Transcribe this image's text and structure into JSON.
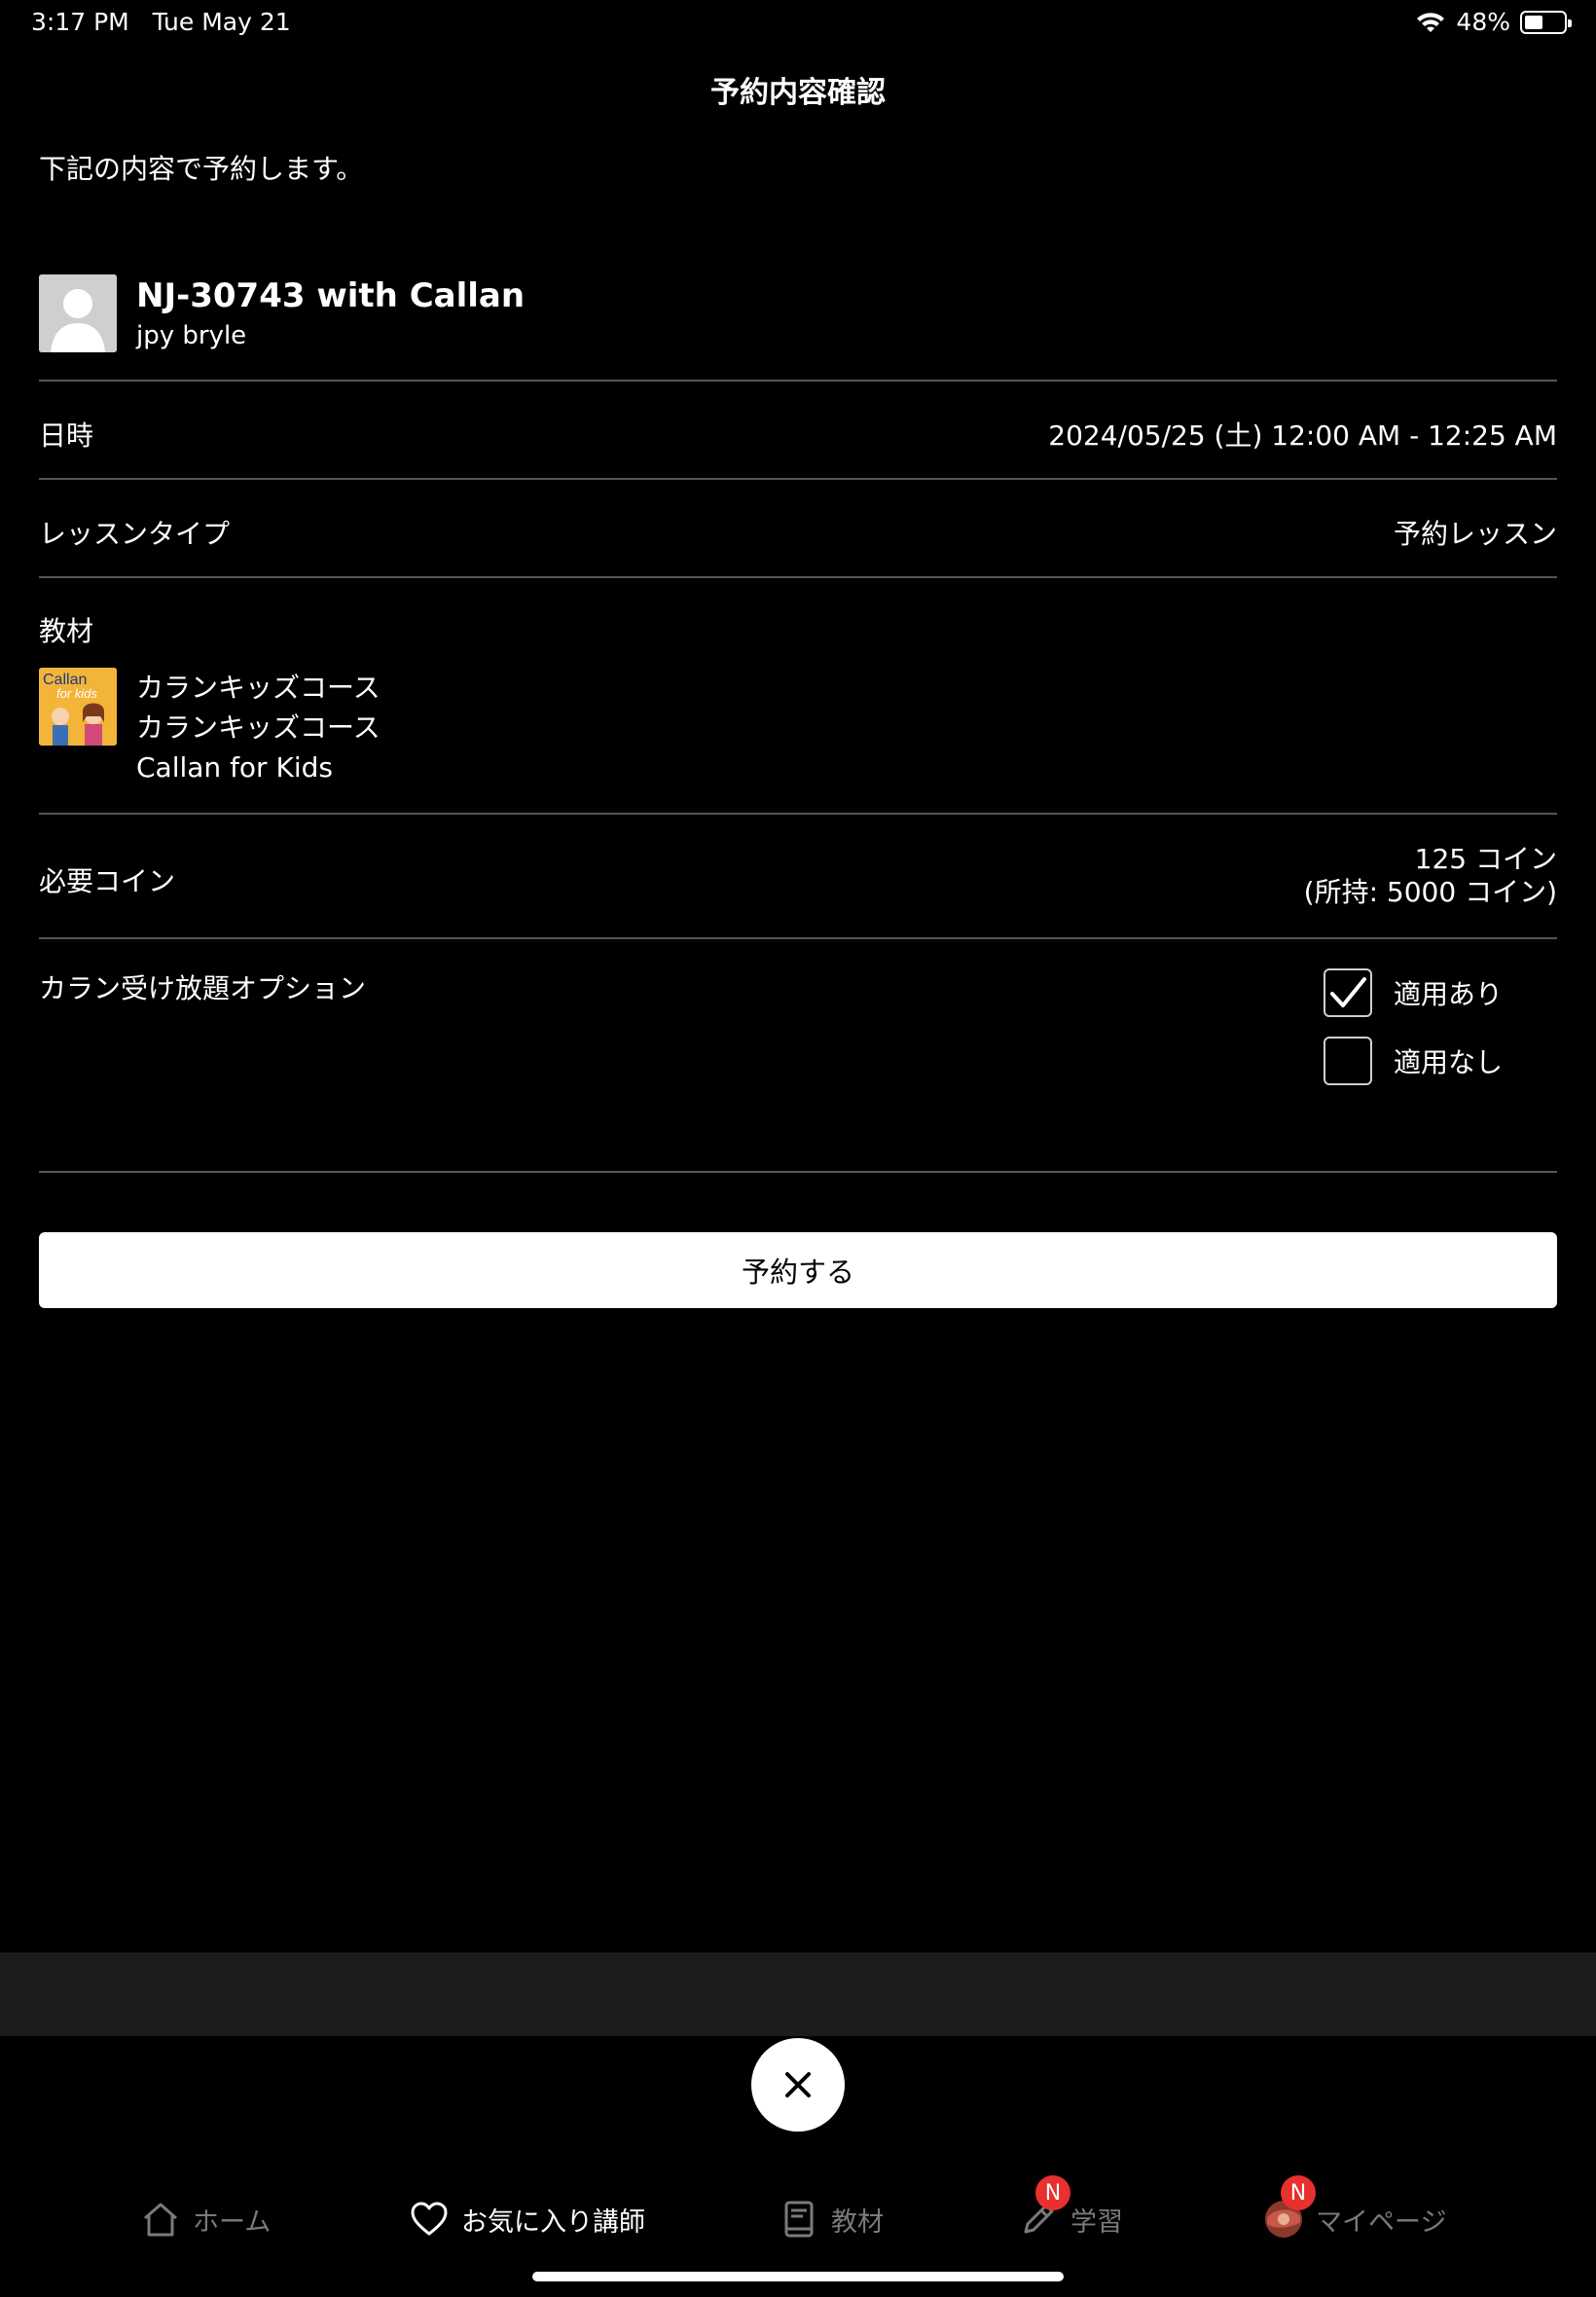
{
  "status_bar": {
    "time": "3:17 PM",
    "date": "Tue May 21",
    "battery": "48%",
    "battery_level": 0.48
  },
  "header": {
    "title": "予約内容確認"
  },
  "intro": "下記の内容で予約します。",
  "teacher": {
    "title": "NJ-30743 with Callan",
    "subtitle": "jpy bryle"
  },
  "rows": {
    "datetime": {
      "label": "日時",
      "value": "2024/05/25 (土) 12:00 AM - 12:25 AM"
    },
    "lesson_type": {
      "label": "レッスンタイプ",
      "value": "予約レッスン"
    },
    "material": {
      "label": "教材",
      "thumb_text_1": "Callan",
      "thumb_text_2": "for kids",
      "line1": "カランキッズコース",
      "line2": "カランキッズコース",
      "line3": "Callan for Kids"
    },
    "coins": {
      "label": "必要コイン",
      "value": "125 コイン",
      "owned": "(所持: 5000 コイン)"
    },
    "option": {
      "label": "カラン受け放題オプション",
      "choices": [
        {
          "label": "適用あり",
          "checked": true
        },
        {
          "label": "適用なし",
          "checked": false
        }
      ]
    }
  },
  "reserve_button": "予約する",
  "tabs": [
    {
      "label": "ホーム",
      "icon": "home-icon",
      "active": false
    },
    {
      "label": "お気に入り講師",
      "icon": "heart-icon",
      "active": true
    },
    {
      "label": "教材",
      "icon": "book-icon",
      "active": false
    },
    {
      "label": "学習",
      "icon": "pencil-icon",
      "active": false,
      "badge": "N"
    },
    {
      "label": "マイページ",
      "icon": "profile-icon",
      "active": false,
      "badge": "N"
    }
  ],
  "colors": {
    "background": "#000000",
    "button_bg": "#ffffff",
    "badge": "#e8302f",
    "divider": "#555555",
    "inactive_tab": "#7a7a7a"
  }
}
